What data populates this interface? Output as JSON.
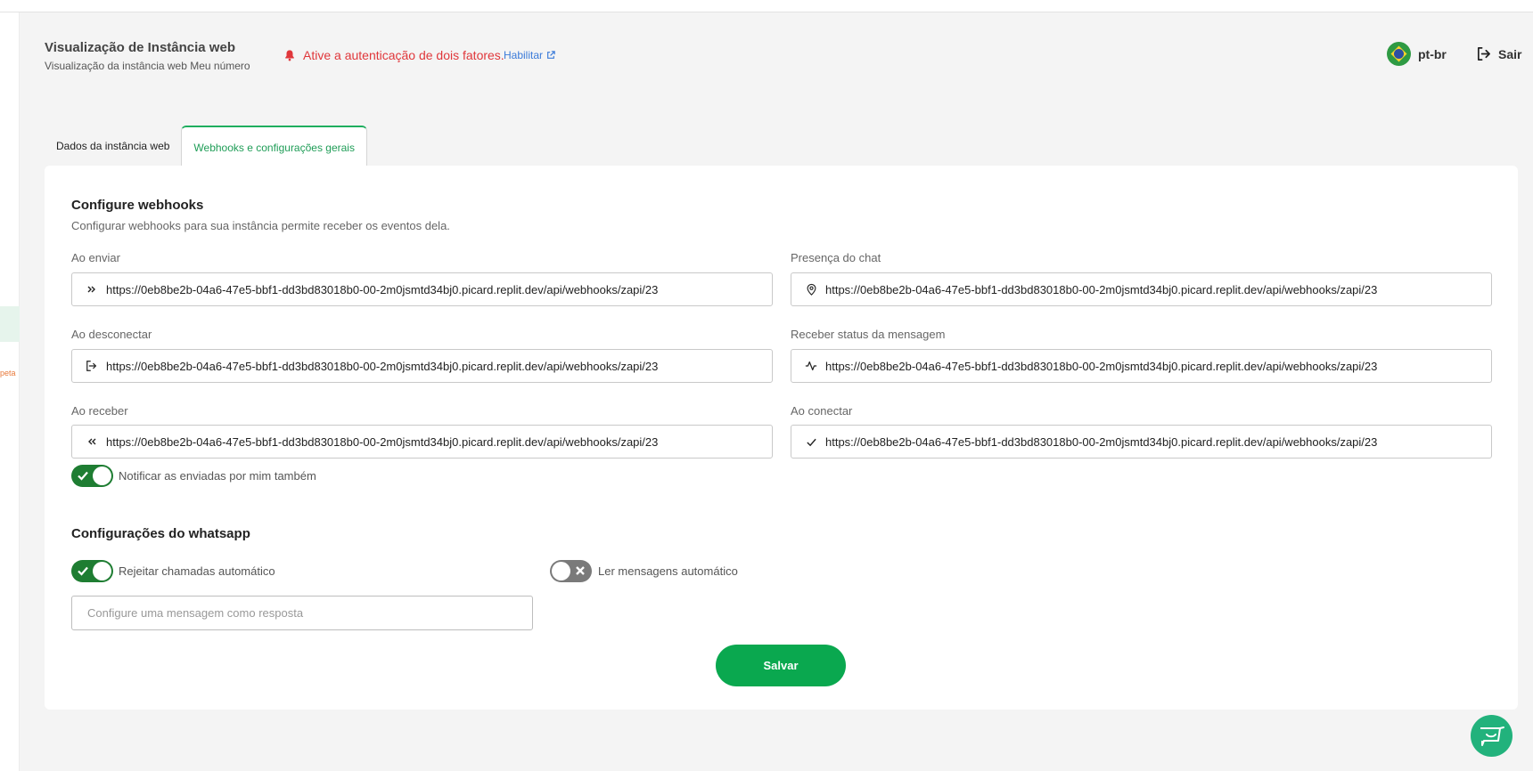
{
  "header": {
    "title": "Visualização de Instância web",
    "subtitle": "Visualização da instância web Meu número",
    "alert_text": "Ative a autenticação de dois fatores.",
    "enable_link": "Habilitar",
    "language": "pt-br",
    "logout": "Sair"
  },
  "sidebar": {
    "clipped_text": "peta"
  },
  "tabs": [
    {
      "label": "Dados da instância web"
    },
    {
      "label": "Webhooks e configurações gerais"
    }
  ],
  "webhooks": {
    "title": "Configure webhooks",
    "subtitle": "Configurar webhooks para sua instância permite receber os eventos dela.",
    "fields": {
      "on_send": {
        "label": "Ao enviar",
        "value": "https://0eb8be2b-04a6-47e5-bbf1-dd3bd83018b0-00-2m0jsmtd34bj0.picard.replit.dev/api/webhooks/zapi/23",
        "icon": "double-chevron-right-icon"
      },
      "chat_presence": {
        "label": "Presença do chat",
        "value": "https://0eb8be2b-04a6-47e5-bbf1-dd3bd83018b0-00-2m0jsmtd34bj0.picard.replit.dev/api/webhooks/zapi/23",
        "icon": "map-pin-icon"
      },
      "on_disconnect": {
        "label": "Ao desconectar",
        "value": "https://0eb8be2b-04a6-47e5-bbf1-dd3bd83018b0-00-2m0jsmtd34bj0.picard.replit.dev/api/webhooks/zapi/23",
        "icon": "logout-icon"
      },
      "message_status": {
        "label": "Receber status da mensagem",
        "value": "https://0eb8be2b-04a6-47e5-bbf1-dd3bd83018b0-00-2m0jsmtd34bj0.picard.replit.dev/api/webhooks/zapi/23",
        "icon": "activity-icon"
      },
      "on_receive": {
        "label": "Ao receber",
        "value": "https://0eb8be2b-04a6-47e5-bbf1-dd3bd83018b0-00-2m0jsmtd34bj0.picard.replit.dev/api/webhooks/zapi/23",
        "icon": "double-chevron-left-icon"
      },
      "on_connect": {
        "label": "Ao conectar",
        "value": "https://0eb8be2b-04a6-47e5-bbf1-dd3bd83018b0-00-2m0jsmtd34bj0.picard.replit.dev/api/webhooks/zapi/23",
        "icon": "check-icon"
      }
    },
    "notify_sent_label": "Notificar as enviadas por mim também",
    "notify_sent_on": true
  },
  "whatsapp": {
    "title": "Configurações do whatsapp",
    "reject_calls_label": "Rejeitar chamadas automático",
    "reject_calls_on": true,
    "read_messages_label": "Ler mensagens automático",
    "read_messages_on": false,
    "reply_placeholder": "Configure uma mensagem como resposta"
  },
  "actions": {
    "save": "Salvar"
  },
  "colors": {
    "primary": "#0aa84f",
    "toggle_on": "#1e7d32",
    "alert": "#e0373b",
    "link": "#3b7bd9"
  }
}
